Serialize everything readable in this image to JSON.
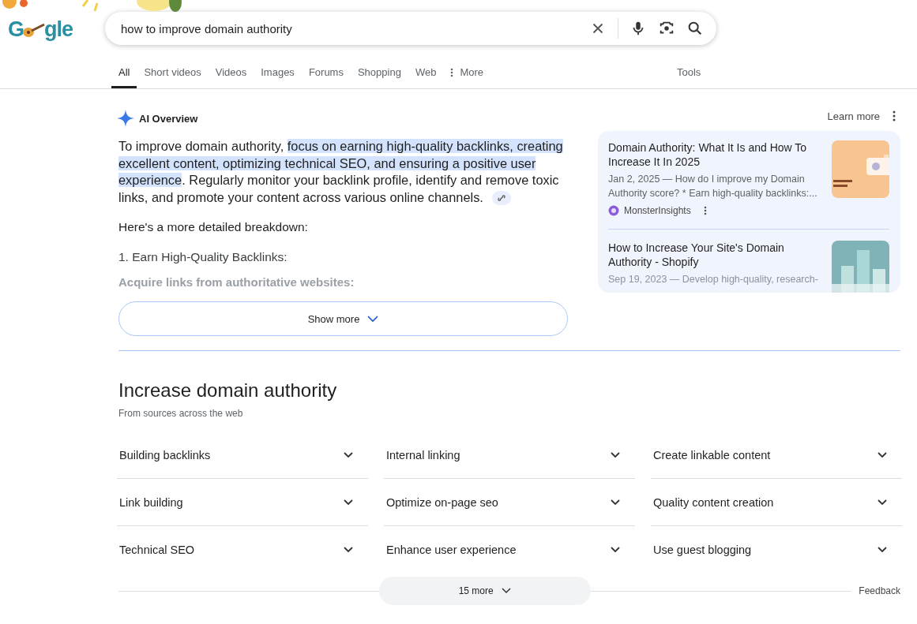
{
  "logo": {
    "lead": "G",
    "tail": "gle"
  },
  "search": {
    "value": "how to improve domain authority"
  },
  "tabs": [
    {
      "label": "All",
      "selected": true
    },
    {
      "label": "Short videos",
      "selected": false
    },
    {
      "label": "Videos",
      "selected": false
    },
    {
      "label": "Images",
      "selected": false
    },
    {
      "label": "Forums",
      "selected": false
    },
    {
      "label": "Shopping",
      "selected": false
    },
    {
      "label": "Web",
      "selected": false
    },
    {
      "label": "More",
      "selected": false,
      "kind": "menu"
    }
  ],
  "tools": "Tools",
  "ai_overview": {
    "title": "AI Overview",
    "learn_more": "Learn more",
    "summary": [
      {
        "text": "To improve domain authority, ",
        "highlighted": false
      },
      {
        "text": "focus on earning high-quality backlinks, creating excellent content, optimizing technical SEO, and ensuring a positive user experience",
        "highlighted": true
      },
      {
        "text": ". Regularly monitor your backlink profile, identify and remove toxic links, and promote your content across various online channels.",
        "highlighted": false
      }
    ],
    "intro": "Here's a more detailed breakdown:",
    "step": "1. Earn High-Quality Backlinks:",
    "faded_line": "Acquire links from authoritative websites:",
    "show_more": "Show more",
    "sources": [
      {
        "title": "Domain Authority: What It Is and How To Increase It In 2025",
        "snippet": "Jan 2, 2025 — How do I improve my Domain Authority score? * Earn high-quality backlinks:...",
        "site": "MonsterInsights",
        "faded": false
      },
      {
        "title": "How to Increase Your Site's Domain Authority - Shopify",
        "snippet": "Sep 19, 2023 — Develop high-quality, research-",
        "faded": true
      }
    ]
  },
  "related": {
    "title": "Increase domain authority",
    "subtitle": "From sources across the web",
    "items": [
      "Building backlinks",
      "Internal linking",
      "Create linkable content",
      "Link building",
      "Optimize on-page seo",
      "Quality content creation",
      "Technical SEO",
      "Enhance user experience",
      "Use guest blogging"
    ],
    "more": "15 more"
  },
  "feedback": "Feedback"
}
